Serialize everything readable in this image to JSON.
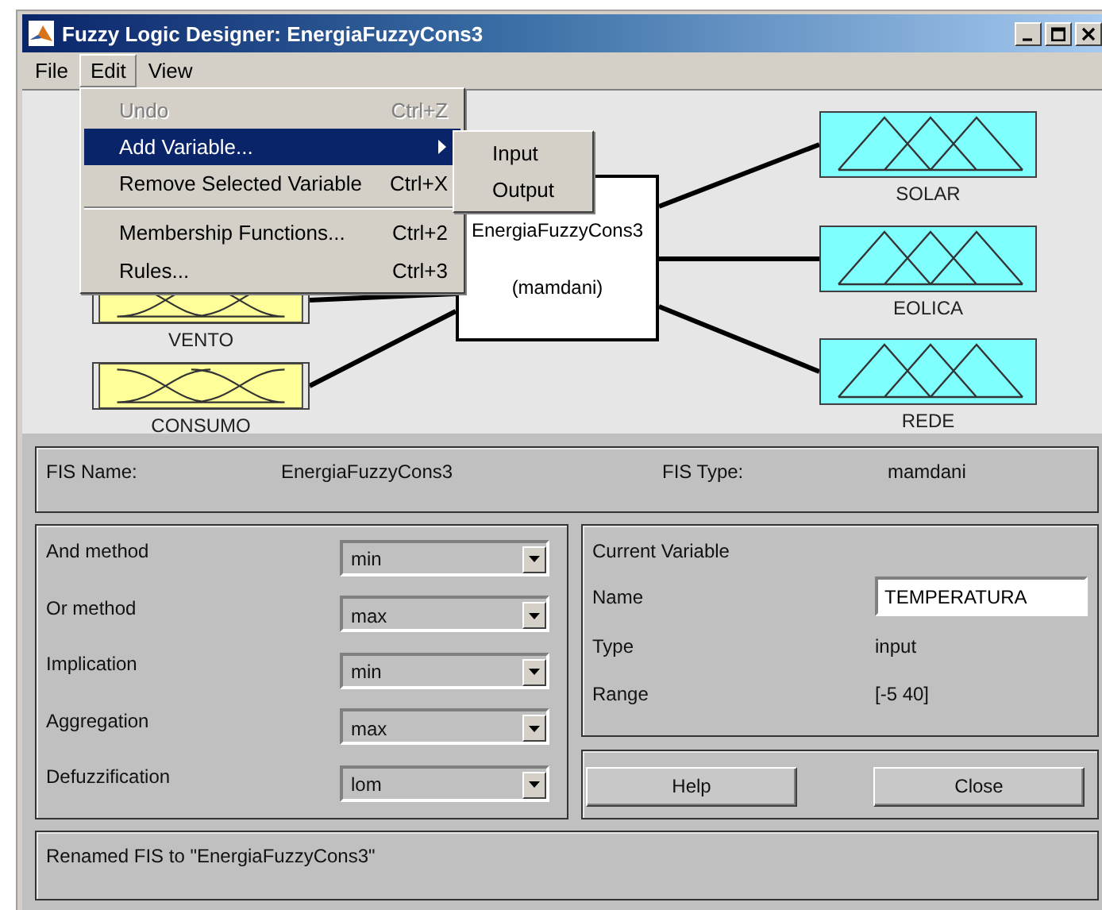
{
  "window": {
    "title": "Fuzzy Logic Designer: EnergiaFuzzyCons3"
  },
  "menu_bar": [
    {
      "label": "File",
      "selected": false
    },
    {
      "label": "Edit",
      "selected": true
    },
    {
      "label": "View",
      "selected": false
    }
  ],
  "edit_menu": [
    {
      "label": "Undo",
      "shortcut": "Ctrl+Z",
      "disabled": true,
      "selected": false,
      "has_submenu": false,
      "separator_before": false
    },
    {
      "label": "Add Variable...",
      "disabled": false,
      "selected": true,
      "has_submenu": true,
      "separator_before": false
    },
    {
      "label": "Remove Selected Variable",
      "shortcut": "Ctrl+X",
      "disabled": false,
      "selected": false,
      "has_submenu": false,
      "separator_before": false
    },
    {
      "label": "Membership Functions...",
      "shortcut": "Ctrl+2",
      "disabled": false,
      "selected": false,
      "has_submenu": false,
      "separator_before": true
    },
    {
      "label": "Rules...",
      "shortcut": "Ctrl+3",
      "disabled": false,
      "selected": false,
      "has_submenu": false,
      "separator_before": false
    }
  ],
  "submenu": [
    {
      "label": "Input",
      "selected": false
    },
    {
      "label": "Output",
      "selected": false
    }
  ],
  "diagram": {
    "inputs": [
      {
        "label": "VENTO"
      },
      {
        "label": "CONSUMO"
      }
    ],
    "system": {
      "name": "EnergiaFuzzyCons3",
      "type": "(mamdani)"
    },
    "outputs": [
      {
        "label": "SOLAR"
      },
      {
        "label": "EOLICA"
      },
      {
        "label": "REDE"
      }
    ]
  },
  "fis_info": {
    "name_label": "FIS Name:",
    "name": "EnergiaFuzzyCons3",
    "type_label": "FIS Type:",
    "type": "mamdani"
  },
  "methods": [
    {
      "label": "And method",
      "value": "min"
    },
    {
      "label": "Or method",
      "value": "max"
    },
    {
      "label": "Implication",
      "value": "min"
    },
    {
      "label": "Aggregation",
      "value": "max"
    },
    {
      "label": "Defuzzification",
      "value": "lom"
    }
  ],
  "current_variable": {
    "title": "Current Variable",
    "name_label": "Name",
    "name_value": "TEMPERATURA",
    "type_label": "Type",
    "type": "input",
    "range_label": "Range",
    "range": "[-5 40]"
  },
  "buttons": [
    "Help",
    "Close"
  ],
  "status_bar": {
    "text": "Renamed FIS to \"EnergiaFuzzyCons3\""
  }
}
